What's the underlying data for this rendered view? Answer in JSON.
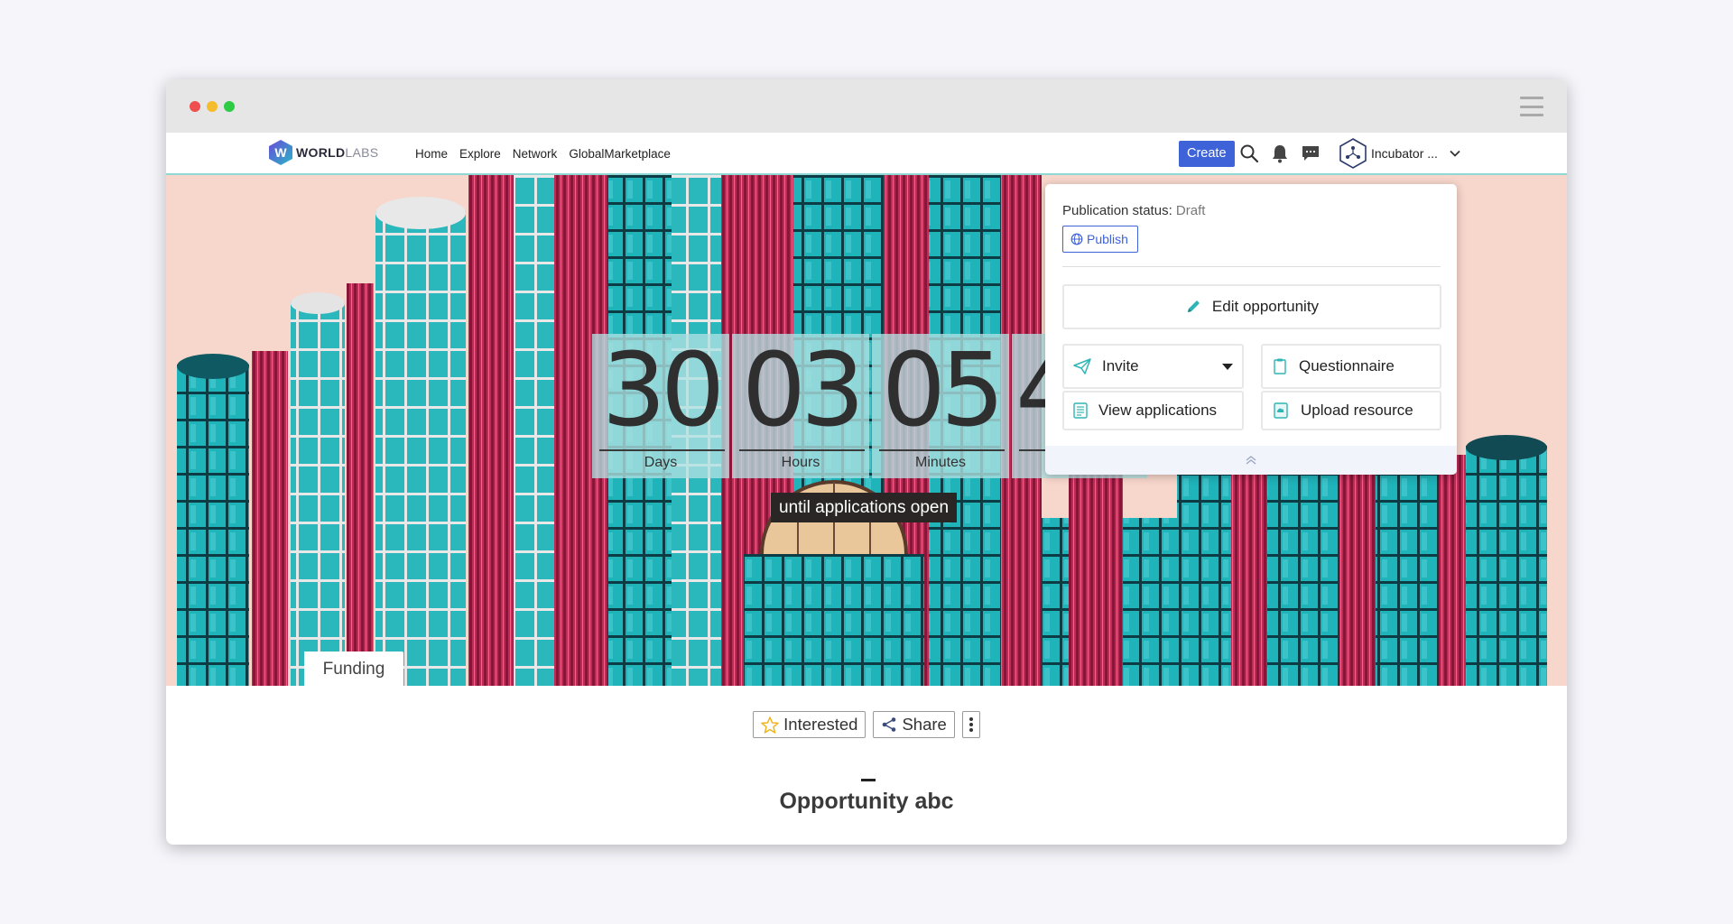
{
  "window": {
    "controls": [
      "close",
      "minimize",
      "maximize"
    ]
  },
  "navbar": {
    "logo": {
      "bold": "WORLD",
      "light": "LABS",
      "letter": "W",
      "icon": "worldlabs-hex-logo"
    },
    "menu": [
      {
        "label": "Home"
      },
      {
        "label": "Explore"
      },
      {
        "label": "Network"
      },
      {
        "label": "GlobalMarketplace"
      }
    ],
    "create_label": "Create",
    "icons": [
      "search-icon",
      "bell-icon",
      "chat-icon"
    ],
    "org_name": "Incubator ..."
  },
  "hero": {
    "countdown": [
      {
        "value": "30",
        "label": "Days"
      },
      {
        "value": "03",
        "label": "Hours"
      },
      {
        "value": "05",
        "label": "Minutes"
      },
      {
        "value": "4",
        "label": ""
      }
    ],
    "until_text": "until applications open",
    "category_tab": "Funding"
  },
  "dropdown": {
    "status_label": "Publication status:",
    "status_value": "Draft",
    "publish_label": "Publish",
    "edit_label": "Edit opportunity",
    "invite_label": "Invite",
    "questionnaire_label": "Questionnaire",
    "view_applications_label": "View applications",
    "upload_resource_label": "Upload resource"
  },
  "actions": {
    "interested_label": "Interested",
    "share_label": "Share"
  },
  "opportunity_title": "Opportunity abc",
  "colors": {
    "accent_blue": "#3e63d9",
    "teal": "#2fb5b4",
    "navbar_border": "#8fd8d3"
  }
}
